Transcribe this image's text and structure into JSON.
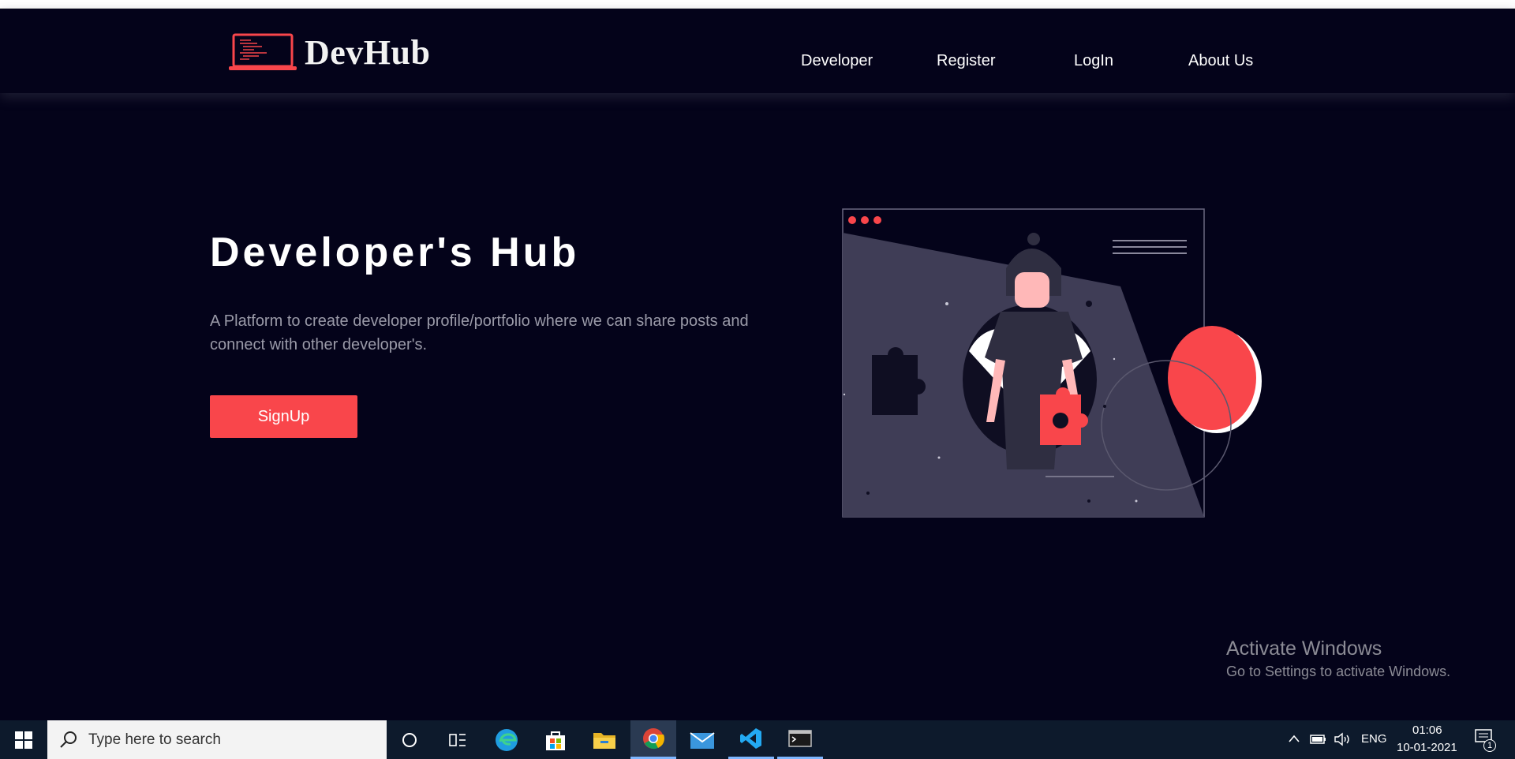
{
  "brand": {
    "name": "DevHub"
  },
  "nav": {
    "developer": "Developer",
    "register": "Register",
    "login": "LogIn",
    "about": "About Us"
  },
  "hero": {
    "title": "Developer's Hub",
    "description": "A Platform to create developer profile/portfolio where we can share posts and connect with other developer's.",
    "signup_label": "SignUp"
  },
  "watermark": {
    "title": "Activate Windows",
    "subtitle": "Go to Settings to activate Windows."
  },
  "taskbar": {
    "search_placeholder": "Type here to search",
    "language": "ENG",
    "time": "01:06",
    "date": "10-01-2021",
    "notification_count": "1",
    "apps": [
      "cortana-icon",
      "task-view-icon",
      "edge-icon",
      "store-icon",
      "file-explorer-icon",
      "chrome-icon",
      "mail-icon",
      "vscode-icon",
      "terminal-icon"
    ]
  },
  "colors": {
    "background": "#04031a",
    "accent": "#f9464b",
    "illustration_panel": "#3f3d56"
  }
}
